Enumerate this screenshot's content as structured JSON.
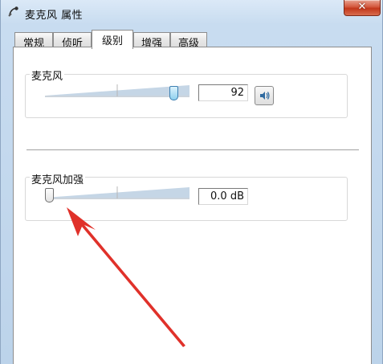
{
  "window": {
    "title": "麦克风 属性",
    "close_label": "✕"
  },
  "tabs": [
    {
      "label": "常规"
    },
    {
      "label": "侦听"
    },
    {
      "label": "级别"
    },
    {
      "label": "增强"
    },
    {
      "label": "高级"
    }
  ],
  "active_tab": "级别",
  "microphone": {
    "label": "麦克风",
    "value": "92",
    "level_percent": 92,
    "speaker_icon": "speaker-icon"
  },
  "boost": {
    "label": "麦克风加强",
    "value": "0.0 dB",
    "level_percent": 0
  },
  "colors": {
    "accent": "#3c7fb1",
    "arrow": "#e0312a",
    "close": "#c2371b"
  }
}
